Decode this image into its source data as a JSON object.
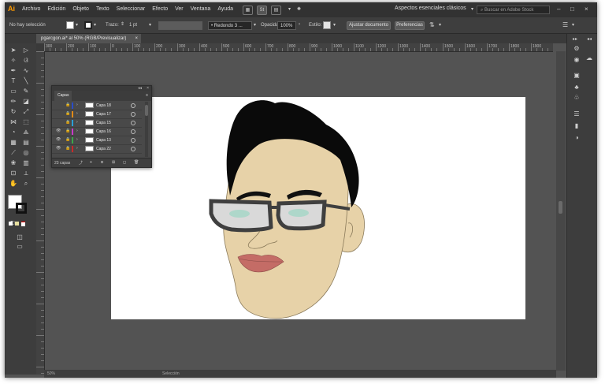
{
  "app": {
    "logo": "Ai",
    "menus": [
      "Archivo",
      "Edición",
      "Objeto",
      "Texto",
      "Seleccionar",
      "Efecto",
      "Ver",
      "Ventana",
      "Ayuda"
    ],
    "workspace": "Aspectos esenciales clásicos",
    "search_placeholder": "Buscar en Adobe Stock",
    "window_controls": [
      "–",
      "□",
      "×"
    ]
  },
  "control_bar": {
    "selection_label": "No hay selección",
    "stroke_label": "Trazo:",
    "stroke_value": "1 pt",
    "brush_value": "Redondo 3 ...",
    "opacity_label": "Opacidad:",
    "opacity_value": "100%",
    "style_label": "Estilo:",
    "adjust_doc_button": "Ajustar documento",
    "preferences_button": "Preferencias"
  },
  "document": {
    "tab_title": "pgarcgon.ai* al 50% (RGB/Previsualizar)",
    "tab_close": "×"
  },
  "ruler": {
    "h_labels": [
      "300",
      "200",
      "100",
      "0",
      "100",
      "200",
      "300",
      "400",
      "500",
      "600",
      "700",
      "800",
      "900",
      "1000",
      "1100",
      "1200",
      "1300",
      "1400",
      "1500",
      "1600",
      "1700",
      "1800",
      "1900"
    ]
  },
  "layers_panel": {
    "tab": "Capas",
    "collapse": "◂◂",
    "close": "×",
    "menu": "≡",
    "footer": "23 capas",
    "layers": [
      {
        "name": "Capa 18",
        "color": "#2a4dc9",
        "visible": false
      },
      {
        "name": "Capa 17",
        "color": "#e08a18",
        "visible": false
      },
      {
        "name": "Capa 15",
        "color": "#2a9fd6",
        "visible": false
      },
      {
        "name": "Capa 16",
        "color": "#c93ac9",
        "visible": true
      },
      {
        "name": "Capa 13",
        "color": "#3aa84a",
        "visible": true
      },
      {
        "name": "Capa 22",
        "color": "#c92a2a",
        "visible": true
      }
    ]
  },
  "statusbar": {
    "zoom": "50%",
    "tool": "Selección"
  },
  "colors": {
    "skin": "#e7d2a8",
    "hair": "#0a0a0a",
    "lips": "#c46c66",
    "glasses_frame": "#3f3f3f",
    "lens": "#d9d9d9",
    "iris": "#9fd6c4"
  },
  "icons": {
    "tools": [
      "selection-icon",
      "direct-selection-icon",
      "magic-wand-icon",
      "lasso-icon",
      "pen-icon",
      "curvature-icon",
      "type-icon",
      "line-icon",
      "rectangle-icon",
      "paintbrush-icon",
      "pencil-icon",
      "eraser-icon",
      "rotate-icon",
      "scale-icon",
      "width-icon",
      "free-transform-icon",
      "shape-builder-icon",
      "perspective-icon",
      "mesh-icon",
      "gradient-icon",
      "eyedropper-icon",
      "blend-icon",
      "symbol-sprayer-icon",
      "column-graph-icon",
      "artboard-icon",
      "slice-icon",
      "hand-icon",
      "zoom-icon"
    ],
    "dock": [
      "properties-icon",
      "libraries-icon",
      "image-trace-icon",
      "puppet-icon",
      "stroke-icon",
      "gradient-panel-icon",
      "transparency-icon",
      "appearance-icon"
    ]
  }
}
